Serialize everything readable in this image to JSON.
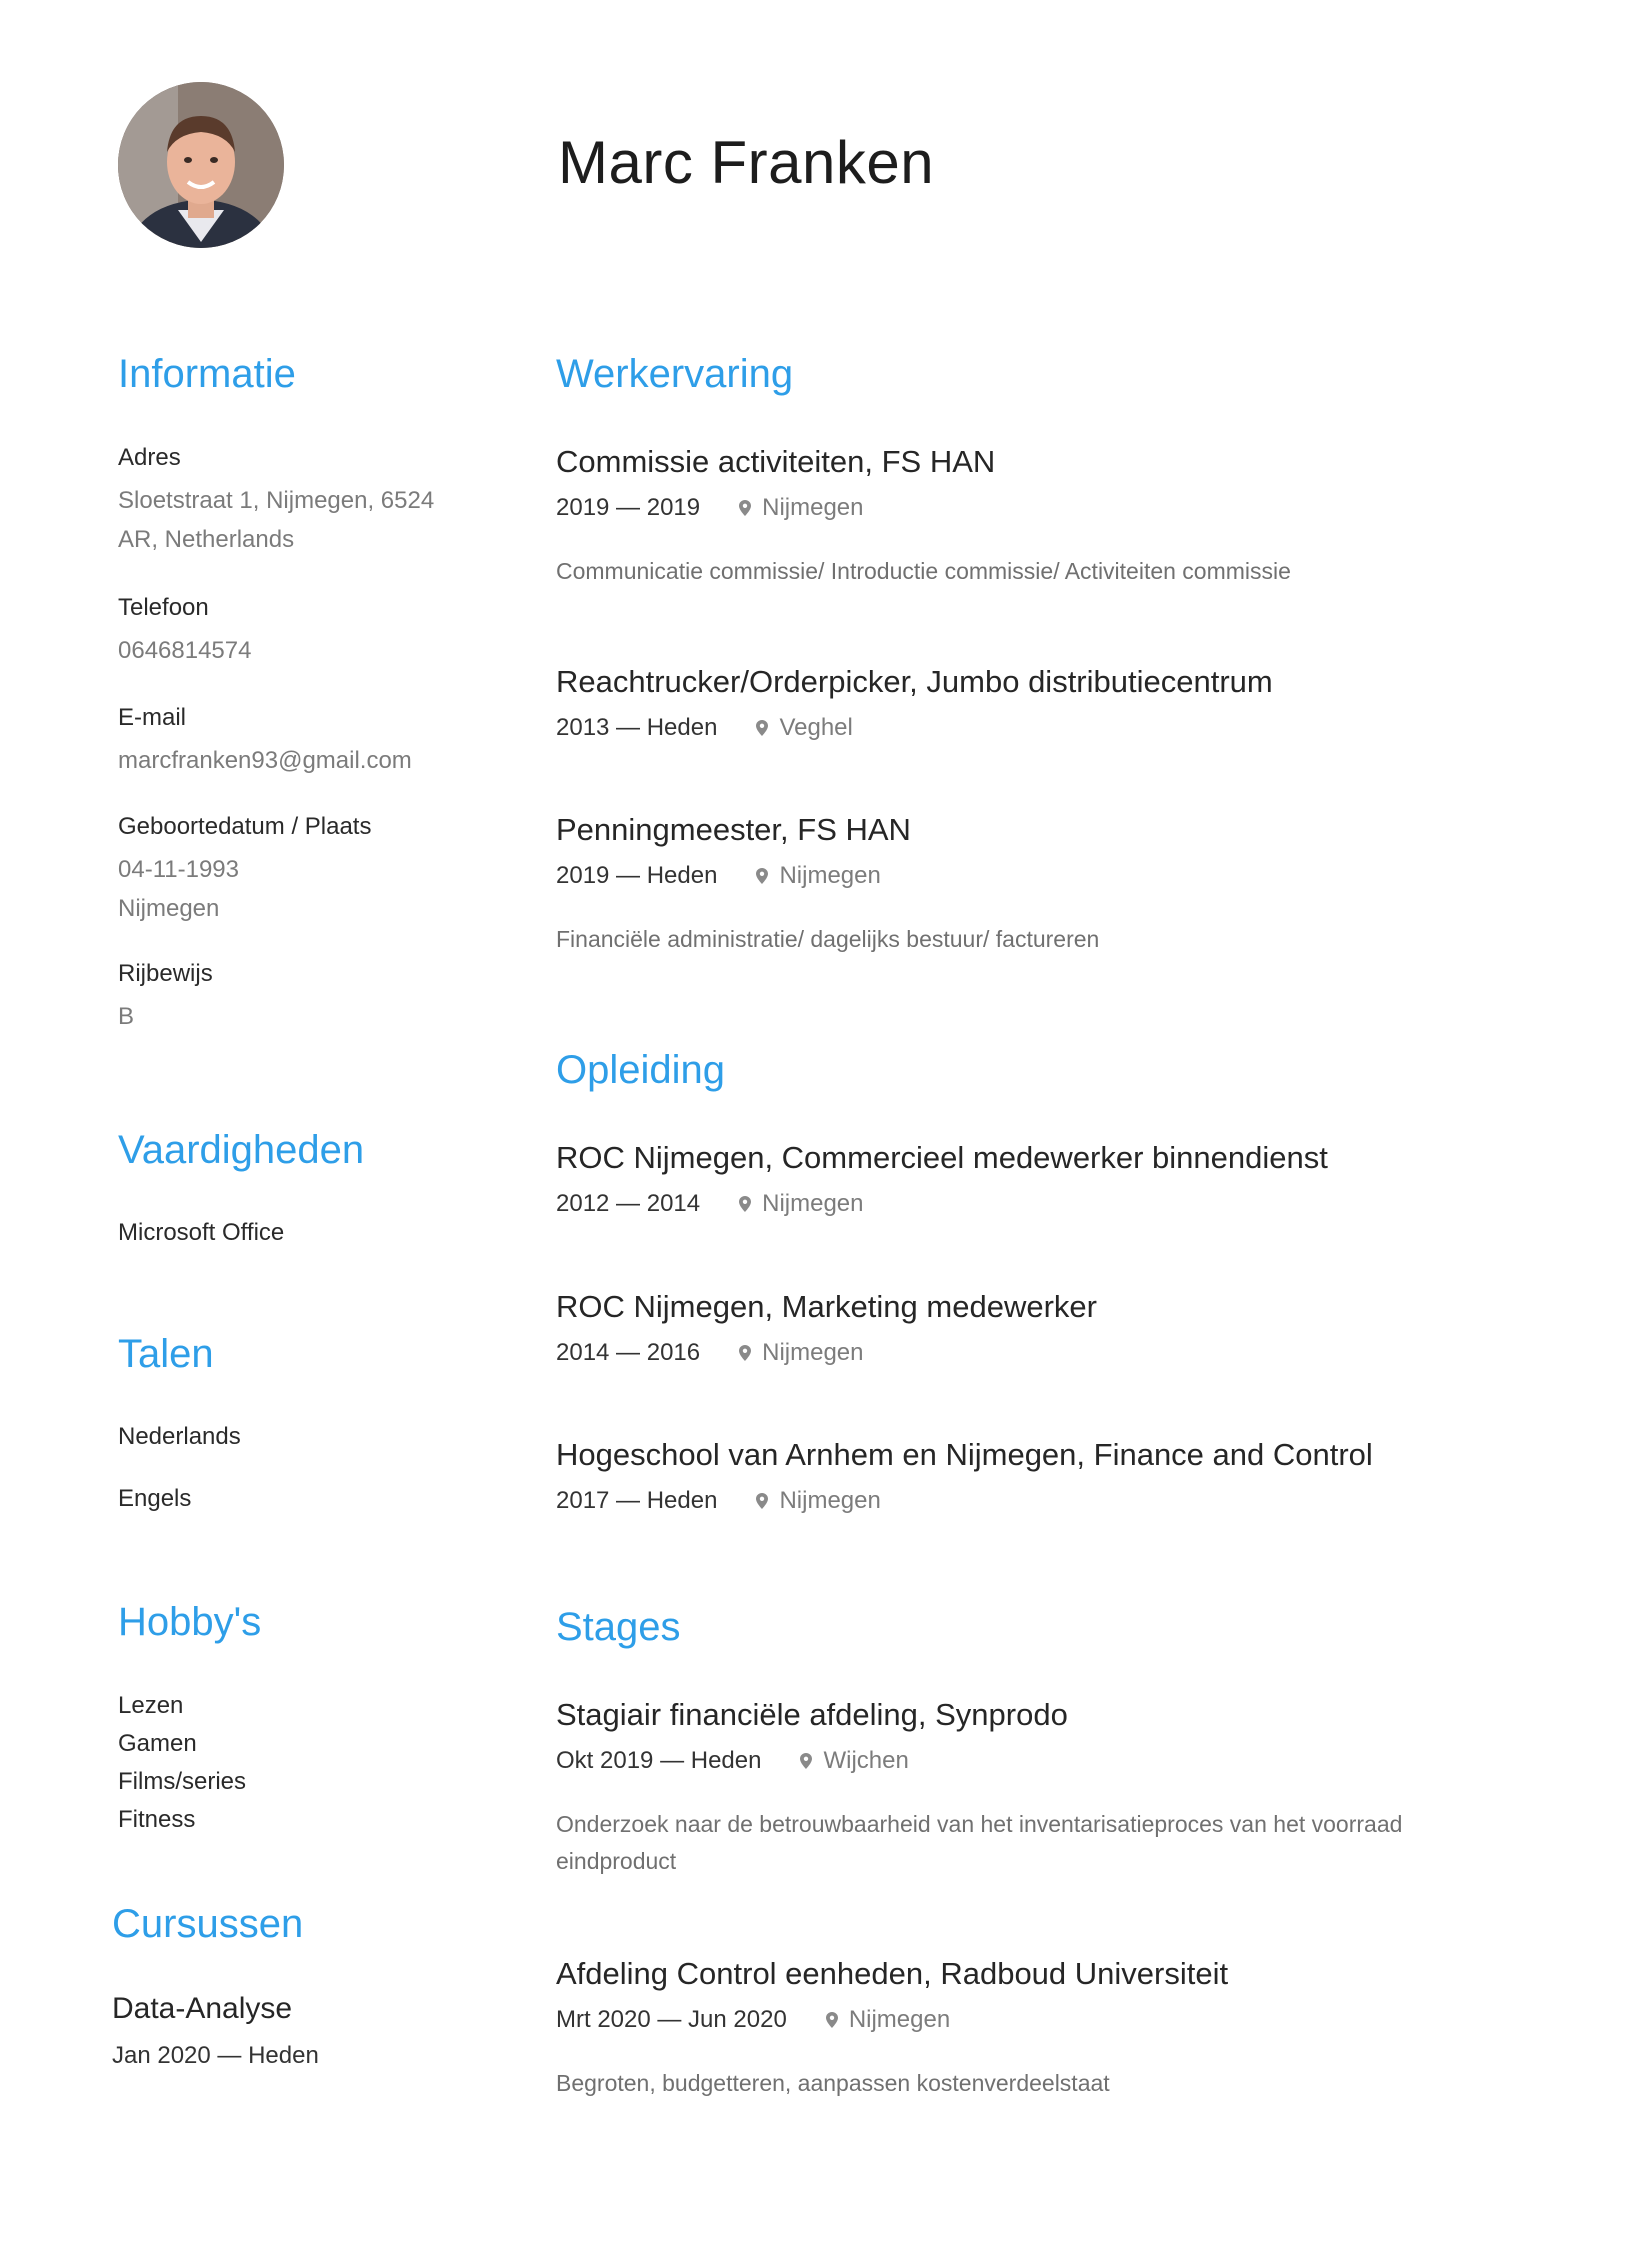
{
  "name": "Marc Franken",
  "colors": {
    "accent": "#2e9ee8",
    "text": "#262626",
    "muted": "#7b7b7b"
  },
  "sidebar": {
    "informatie": {
      "heading": "Informatie",
      "adres_label": "Adres",
      "adres_line1": "Sloetstraat 1, Nijmegen, 6524",
      "adres_line2": "AR, Netherlands",
      "telefoon_label": "Telefoon",
      "telefoon": "0646814574",
      "email_label": "E-mail",
      "email": "marcfranken93@gmail.com",
      "geboorte_label": "Geboortedatum / Plaats",
      "geboortedatum": "04-11-1993",
      "geboorteplaats": "Nijmegen",
      "rijbewijs_label": "Rijbewijs",
      "rijbewijs": "B"
    },
    "vaardigheden": {
      "heading": "Vaardigheden",
      "items": [
        "Microsoft Office"
      ]
    },
    "talen": {
      "heading": "Talen",
      "items": [
        "Nederlands",
        "Engels"
      ]
    },
    "hobbys": {
      "heading": "Hobby's",
      "items": [
        "Lezen",
        "Gamen",
        "Films/series",
        "Fitness"
      ]
    },
    "cursussen": {
      "heading": "Cursussen",
      "title": "Data-Analyse",
      "period": "Jan 2020 — Heden"
    }
  },
  "werkervaring": {
    "heading": "Werkervaring",
    "items": [
      {
        "title": "Commissie activiteiten, FS HAN",
        "period": "2019 — 2019",
        "location": "Nijmegen",
        "description": "Communicatie commissie/ Introductie commissie/ Activiteiten commissie"
      },
      {
        "title": "Reachtrucker/Orderpicker, Jumbo distributiecentrum",
        "period": "2013 — Heden",
        "location": "Veghel"
      },
      {
        "title": "Penningmeester, FS HAN",
        "period": "2019 — Heden",
        "location": "Nijmegen",
        "description": "Financiële administratie/ dagelijks bestuur/ factureren"
      }
    ]
  },
  "opleiding": {
    "heading": "Opleiding",
    "items": [
      {
        "title": "ROC Nijmegen, Commercieel medewerker binnendienst",
        "period": "2012 — 2014",
        "location": "Nijmegen"
      },
      {
        "title": "ROC Nijmegen, Marketing medewerker",
        "period": "2014 — 2016",
        "location": "Nijmegen"
      },
      {
        "title": "Hogeschool van Arnhem en Nijmegen, Finance and Control",
        "period": "2017 — Heden",
        "location": "Nijmegen"
      }
    ]
  },
  "stages": {
    "heading": "Stages",
    "items": [
      {
        "title": "Stagiair financiële afdeling, Synprodo",
        "period": "Okt 2019 — Heden",
        "location": "Wijchen",
        "description_line1": "Onderzoek naar de betrouwbaarheid van het inventarisatieproces van het voorraad",
        "description_line2": "eindproduct"
      },
      {
        "title": "Afdeling Control eenheden, Radboud Universiteit",
        "period": "Mrt 2020 — Jun 2020",
        "location": "Nijmegen",
        "description": "Begroten, budgetteren, aanpassen kostenverdeelstaat"
      }
    ]
  }
}
